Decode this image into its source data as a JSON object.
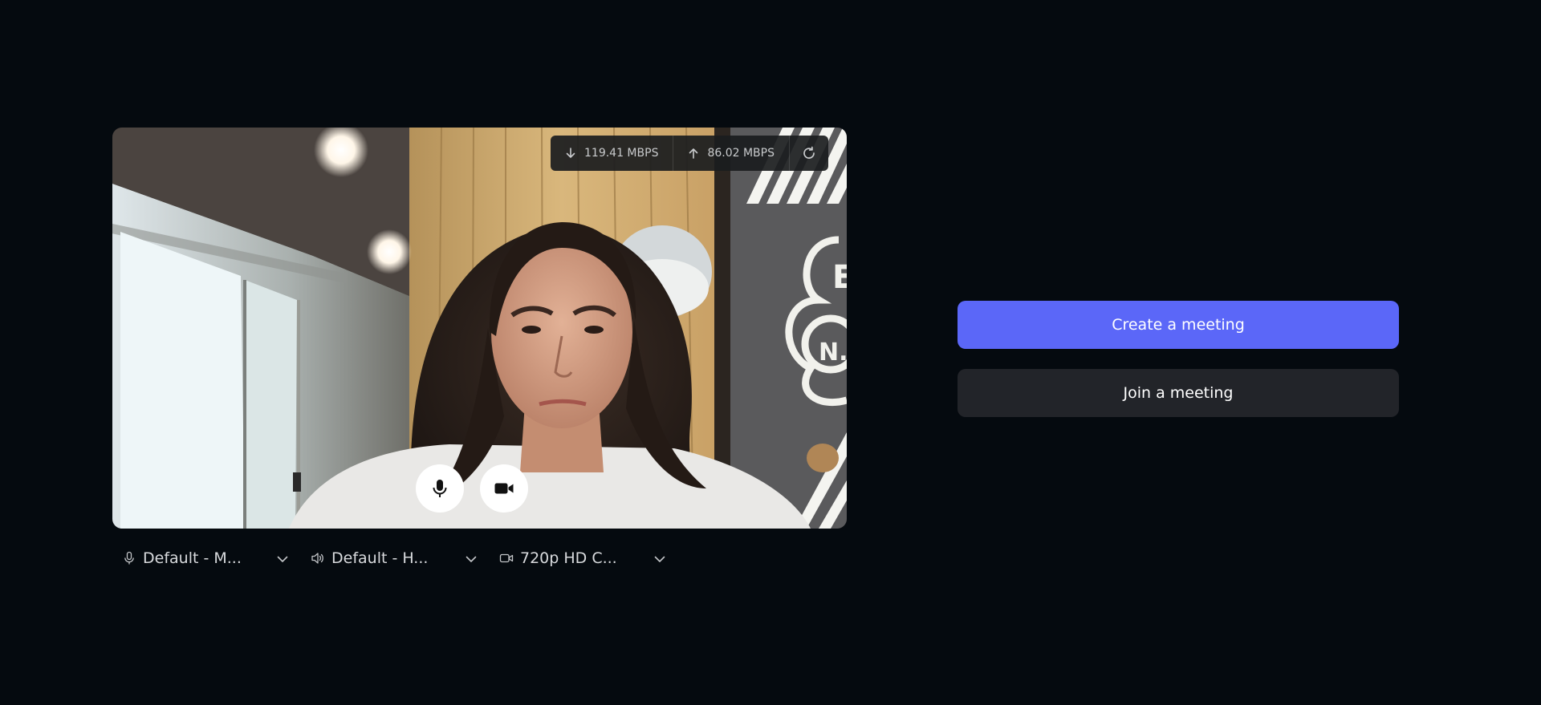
{
  "colors": {
    "background": "#050a0f",
    "primary_button": "#5b67f8",
    "secondary_button": "#222429",
    "stats_bar": "#1a1c1e"
  },
  "preview": {
    "network": {
      "download": "119.41 MBPS",
      "upload": "86.02 MBPS",
      "download_icon": "arrow-down-icon",
      "upload_icon": "arrow-up-icon",
      "refresh_icon": "refresh-icon"
    },
    "controls": {
      "mic_icon": "microphone-icon",
      "camera_icon": "video-camera-icon"
    }
  },
  "devices": {
    "microphone": {
      "value": "Default - M...",
      "icon": "microphone-icon"
    },
    "speaker": {
      "value": "Default - H...",
      "icon": "speaker-icon"
    },
    "camera": {
      "value": "720p HD C...",
      "icon": "video-camera-icon"
    }
  },
  "actions": {
    "create": "Create a meeting",
    "join": "Join a meeting"
  }
}
